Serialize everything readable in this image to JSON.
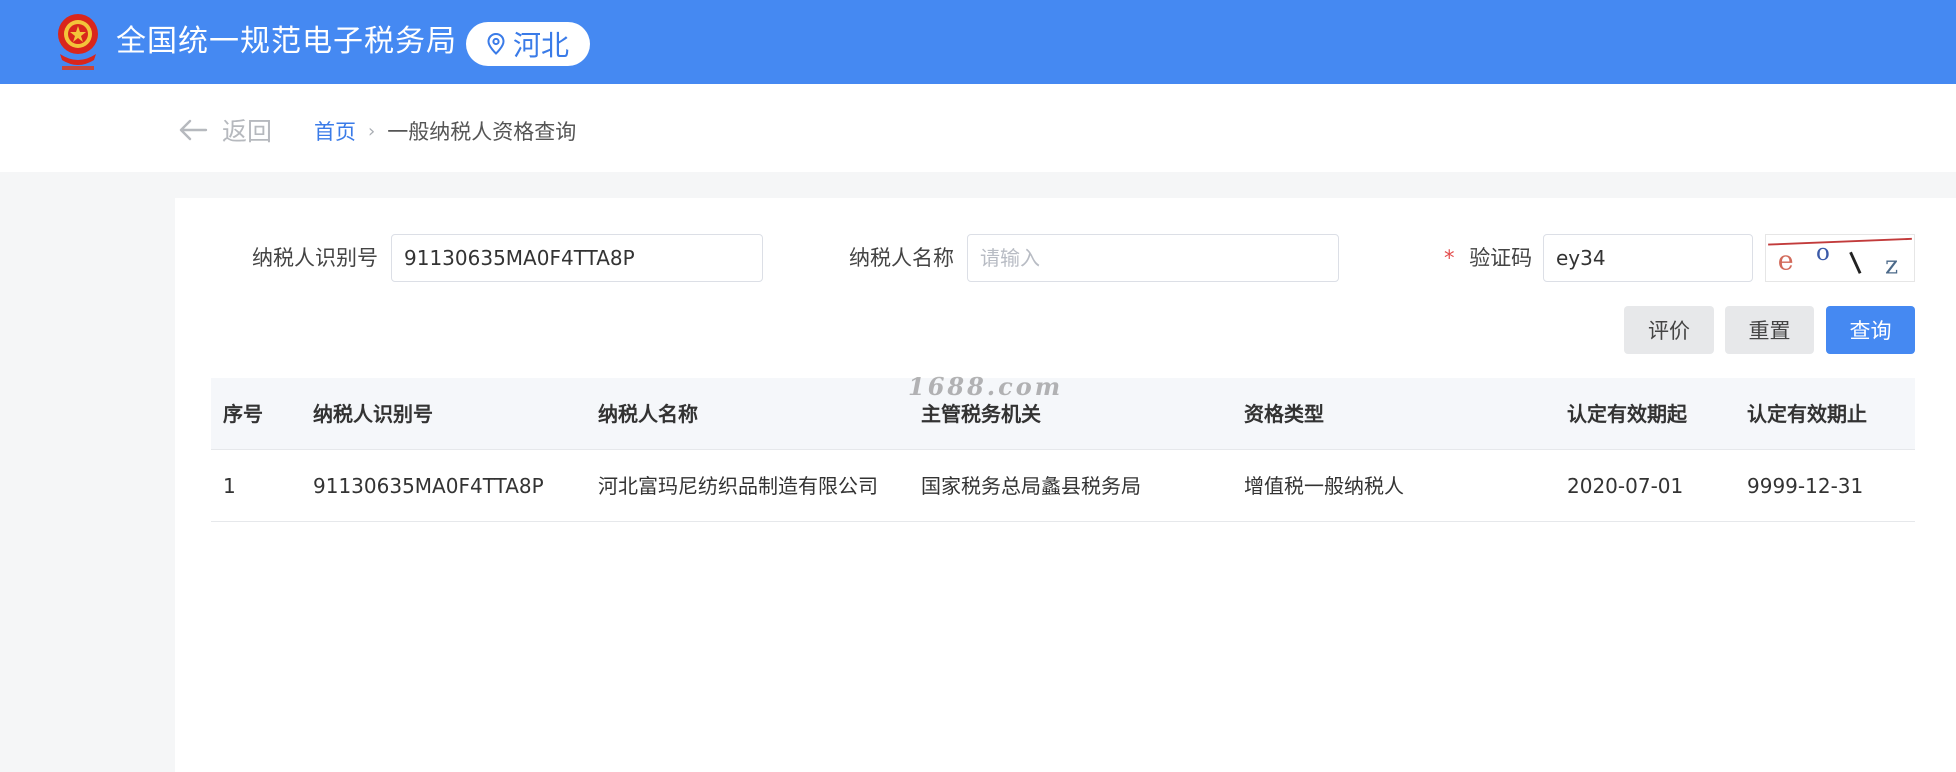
{
  "header": {
    "title": "全国统一规范电子税务局",
    "region": "河北",
    "accent_color": "#4589f2"
  },
  "breadcrumb": {
    "back_label": "返回",
    "home": "首页",
    "separator": "›",
    "current": "一般纳税人资格查询"
  },
  "form": {
    "taxpayer_id_label": "纳税人识别号",
    "taxpayer_id_value": "91130635MA0F4TTA8P",
    "taxpayer_name_label": "纳税人名称",
    "taxpayer_name_placeholder": "请输入",
    "captcha_required_mark": "*",
    "captcha_label": "验证码",
    "captcha_value": "ey34",
    "captcha_image_text": "eo/z"
  },
  "buttons": {
    "evaluate": "评价",
    "reset": "重置",
    "query": "查询"
  },
  "table": {
    "columns": [
      "序号",
      "纳税人识别号",
      "纳税人名称",
      "主管税务机关",
      "资格类型",
      "认定有效期起",
      "认定有效期止"
    ],
    "rows": [
      [
        "1",
        "91130635MA0F4TTA8P",
        "河北富玛尼纺织品制造有限公司",
        "国家税务总局蠡县税务局",
        "增值税一般纳税人",
        "2020-07-01",
        "9999-12-31"
      ]
    ]
  },
  "watermark": "1688.com"
}
